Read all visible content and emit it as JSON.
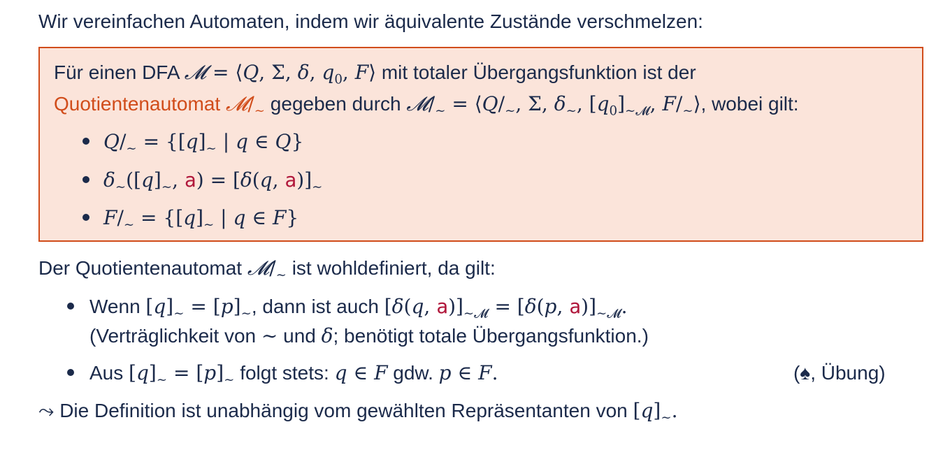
{
  "intro": "Wir vereinfachen Automaten, indem wir äquivalente Zustände verschmelzen:",
  "definition": {
    "text_1": "Für einen DFA",
    "text_2": "mit totaler Übergangsfunktion ist der",
    "term": "Quotientenautomat",
    "text_3": "gegeben durch",
    "text_4": ", wobei gilt:"
  },
  "wohldefiniert": {
    "text_1": "Der Quotientenautomat",
    "text_2": "ist wohldefiniert, da gilt:",
    "b1_wenn": "Wenn",
    "b1_dann": ", dann ist auch",
    "b1_line2_a": "(Verträglichkeit von",
    "b1_line2_b": "und",
    "b1_line2_c": "; benötigt totale Übergangsfunktion.)",
    "b2_aus": "Aus",
    "b2_folgt": "folgt stets:",
    "b2_gdw": "gdw.",
    "b2_note": "(♠, Übung)"
  },
  "conclusion": {
    "text": "Die Definition ist unabhängig vom gewählten Repräsentanten von"
  },
  "colors": {
    "text": "#1b2a4a",
    "accent": "#d14d1b",
    "box_background": "#fbe4da",
    "letter": "#b0173b"
  }
}
